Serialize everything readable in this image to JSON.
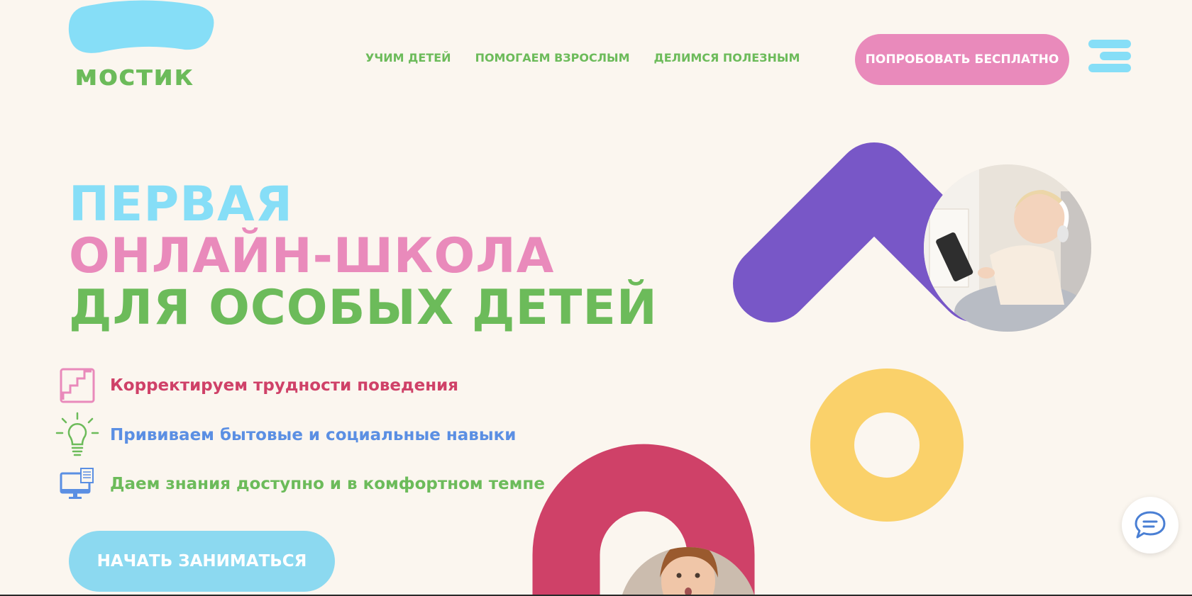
{
  "brand": {
    "name": "мостик"
  },
  "nav": {
    "items": [
      "УЧИМ ДЕТЕЙ",
      "ПОМОГАЕМ ВЗРОСЛЫМ",
      "ДЕЛИМСЯ ПОЛЕЗНЫМ"
    ]
  },
  "header": {
    "cta_label": "ПОПРОБОВАТЬ БЕСПЛАТНО"
  },
  "hero": {
    "title_line1": "ПЕРВАЯ",
    "title_line2": "ОНЛАЙН-ШКОЛА",
    "title_line3": "ДЛЯ ОСОБЫХ ДЕТЕЙ",
    "features": [
      {
        "icon": "stairs-icon",
        "text": "Корректируем трудности поведения"
      },
      {
        "icon": "lightbulb-icon",
        "text": "Прививаем бытовые и социальные навыки"
      },
      {
        "icon": "computer-icon",
        "text": "Даем знания доступно и в комфортном темпе"
      }
    ],
    "cta_label": "НАЧАТЬ ЗАНИМАТЬСЯ"
  },
  "colors": {
    "background": "#fbf6ef",
    "green": "#6cbb5a",
    "light_blue": "#86def7",
    "pink": "#e98abb",
    "crimson": "#cf4168",
    "blue": "#5b8fe3",
    "purple": "#7857c7",
    "yellow": "#fad16a"
  },
  "widgets": {
    "chat_icon": "chat-bubble-icon"
  }
}
